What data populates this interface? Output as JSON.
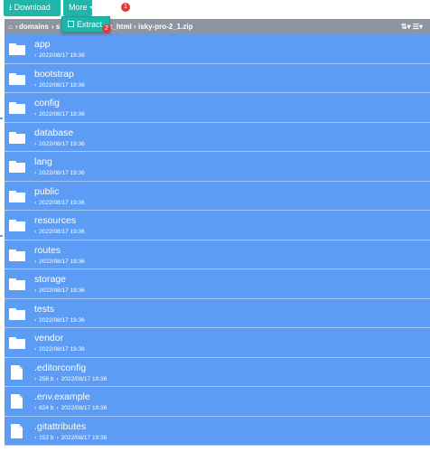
{
  "toolbar": {
    "download_label": "Download",
    "more_label": "More",
    "download_icon": "download-icon",
    "more_caret_icon": "caret-down-icon"
  },
  "dropdown": {
    "extract_label": "Extract",
    "extract_icon": "extract-icon"
  },
  "markers": {
    "one": "1",
    "two": "2"
  },
  "breadcrumb": {
    "home_icon": "home-icon",
    "segments": [
      "domains",
      "s",
      "c_html",
      "isky-pro-2_1.zip"
    ]
  },
  "sort_control": "sort-icon",
  "files": [
    {
      "name": "app",
      "date": "2022/08/17 19:36",
      "type": "folder"
    },
    {
      "name": "bootstrap",
      "date": "2022/08/17 19:36",
      "type": "folder"
    },
    {
      "name": "config",
      "date": "2022/08/17 19:36",
      "type": "folder"
    },
    {
      "name": "database",
      "date": "2022/08/17 19:36",
      "type": "folder"
    },
    {
      "name": "lang",
      "date": "2022/08/17 19:36",
      "type": "folder"
    },
    {
      "name": "public",
      "date": "2022/08/17 19:36",
      "type": "folder"
    },
    {
      "name": "resources",
      "date": "2022/08/17 19:36",
      "type": "folder"
    },
    {
      "name": "routes",
      "date": "2022/08/17 19:36",
      "type": "folder"
    },
    {
      "name": "storage",
      "date": "2022/08/17 19:36",
      "type": "folder"
    },
    {
      "name": "tests",
      "date": "2022/08/17 19:36",
      "type": "folder"
    },
    {
      "name": "vendor",
      "date": "2022/08/17 19:38",
      "type": "folder"
    },
    {
      "name": ".editorconfig",
      "size": "258 b",
      "date": "2022/08/17 19:36",
      "type": "file"
    },
    {
      "name": ".env.example",
      "size": "824 b",
      "date": "2022/08/17 19:36",
      "type": "file"
    },
    {
      "name": ".gitattributes",
      "size": "152 b",
      "date": "2022/08/17 19:36",
      "type": "file"
    }
  ],
  "colors": {
    "accent": "#1fb5a8",
    "row_bg": "#5d9cf4",
    "path_bg": "#8d96a0",
    "marker": "#e53935"
  }
}
